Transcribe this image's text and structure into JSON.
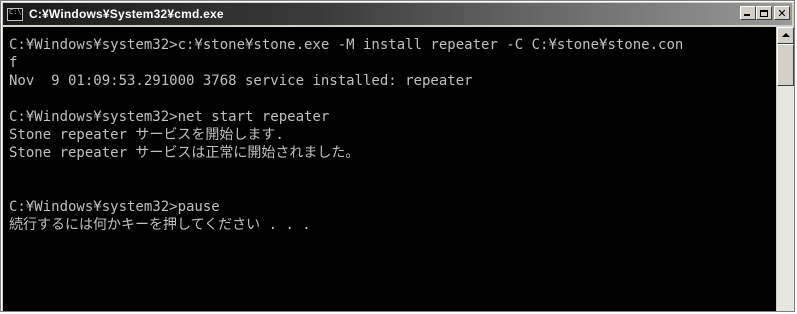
{
  "window": {
    "title": "C:¥Windows¥System32¥cmd.exe",
    "icon_label": "C:\\",
    "icon": "console-icon",
    "buttons": {
      "minimize": "minimize-icon",
      "maximize": "maximize-icon",
      "close_glyph": "✕"
    }
  },
  "console": {
    "foreground": "#c0c0c0",
    "background": "#000000",
    "lines": [
      "C:¥Windows¥system32>c:¥stone¥stone.exe -M install repeater -C C:¥stone¥stone.con",
      "f",
      "Nov  9 01:09:53.291000 3768 service installed: repeater",
      "",
      "C:¥Windows¥system32>net start repeater",
      "Stone repeater サービスを開始します.",
      "Stone repeater サービスは正常に開始されました。",
      "",
      "",
      "C:¥Windows¥system32>pause",
      "続行するには何かキーを押してください . . ."
    ]
  },
  "scrollbar": {
    "position": 0.0
  }
}
